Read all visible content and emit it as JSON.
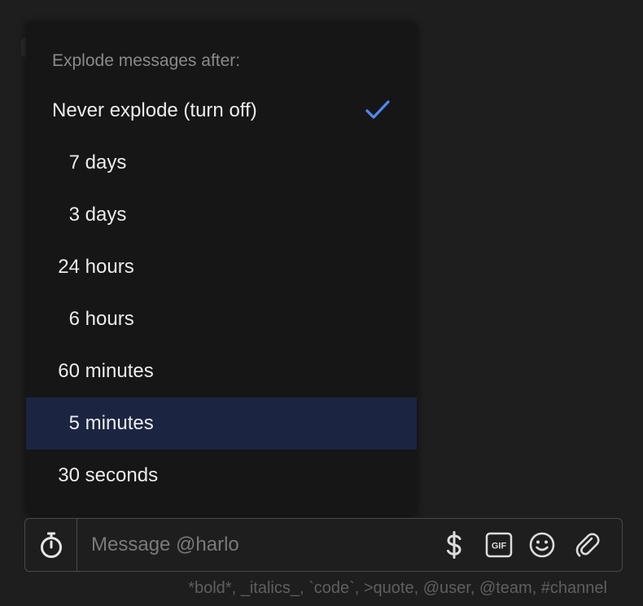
{
  "menu": {
    "header": "Explode messages after:",
    "items": [
      {
        "full": "Never explode (turn off)",
        "checked": true
      },
      {
        "num": "7",
        "unit": "days"
      },
      {
        "num": "3",
        "unit": "days"
      },
      {
        "num": "24",
        "unit": "hours"
      },
      {
        "num": "6",
        "unit": "hours"
      },
      {
        "num": "60",
        "unit": "minutes"
      },
      {
        "num": "5",
        "unit": "minutes",
        "selected": true
      },
      {
        "num": "30",
        "unit": "seconds"
      }
    ]
  },
  "composer": {
    "placeholder": "Message @harlo",
    "gif_label": "GIF"
  },
  "hint": "*bold*, _italics_, `code`, >quote, @user, @team, #channel",
  "colors": {
    "accent": "#4c8bf5",
    "selected_bg": "#1b2542",
    "menu_bg": "#161616",
    "page_bg": "#1e1e1e"
  },
  "icons": {
    "check": "check-icon",
    "timer": "stopwatch-icon",
    "dollar": "dollar-icon",
    "gif": "gif-icon",
    "emoji": "emoji-icon",
    "attach": "paperclip-icon"
  }
}
